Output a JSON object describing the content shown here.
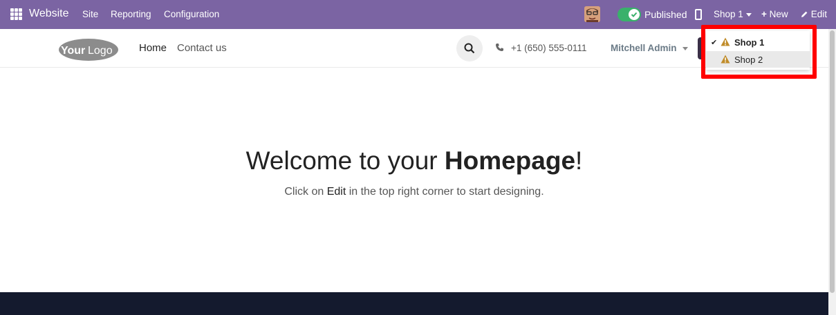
{
  "topbar": {
    "brand": "Website",
    "menu": [
      "Site",
      "Reporting",
      "Configuration"
    ],
    "published_label": "Published",
    "shop_label": "Shop 1",
    "new_label": "New",
    "edit_label": "Edit",
    "toggle_on": true
  },
  "header": {
    "logo_text_bold": "Your",
    "logo_text_light": "Logo",
    "nav": [
      "Home",
      "Contact us"
    ],
    "phone": "+1 (650) 555-0111",
    "user": "Mitchell Admin"
  },
  "main": {
    "title_prefix": "Welcome to your ",
    "title_bold": "Homepage",
    "title_suffix": "!",
    "sub_prefix": "Click on ",
    "sub_bold": "Edit",
    "sub_suffix": " in the top right corner to start designing."
  },
  "shop_dropdown": {
    "items": [
      {
        "label": "Shop 1",
        "selected": true
      },
      {
        "label": "Shop 2",
        "selected": false
      }
    ]
  },
  "colors": {
    "topbar": "#7b64a3",
    "toggle": "#39b16b",
    "warning": "#c08c2a",
    "highlight": "#ff0000",
    "footer": "#141a2e"
  }
}
